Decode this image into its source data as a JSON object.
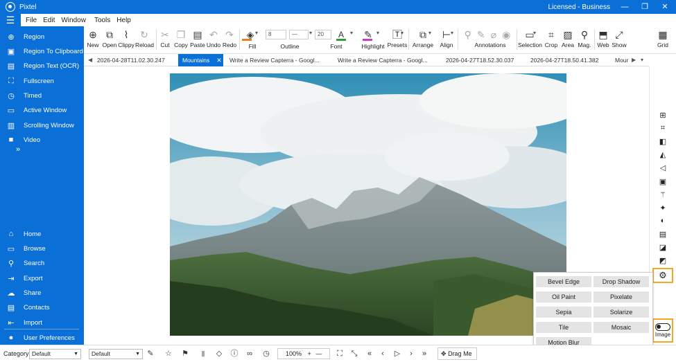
{
  "app": {
    "title": "Pixtel",
    "license": "Licensed - Business",
    "window_buttons": {
      "minimize": "—",
      "restore": "❐",
      "close": "✕"
    }
  },
  "menu": [
    "File",
    "Edit",
    "Window",
    "Tools",
    "Help"
  ],
  "sidebar": {
    "capture": [
      {
        "label": "Region",
        "icon": "region-icon"
      },
      {
        "label": "Region To Clipboard",
        "icon": "clipboard-icon"
      },
      {
        "label": "Region Text (OCR)",
        "icon": "ocr-icon"
      },
      {
        "label": "Fullscreen",
        "icon": "fullscreen-icon"
      },
      {
        "label": "Timed",
        "icon": "timer-icon"
      },
      {
        "label": "Active Window",
        "icon": "window-icon"
      },
      {
        "label": "Scrolling Window",
        "icon": "scroll-icon"
      },
      {
        "label": "Video",
        "icon": "video-icon"
      }
    ],
    "expand": "»",
    "nav": [
      {
        "label": "Home",
        "icon": "home-icon"
      },
      {
        "label": "Browse",
        "icon": "browse-icon"
      },
      {
        "label": "Search",
        "icon": "search-icon"
      },
      {
        "label": "Export",
        "icon": "export-icon"
      },
      {
        "label": "Share",
        "icon": "share-icon"
      },
      {
        "label": "Contacts",
        "icon": "contacts-icon"
      },
      {
        "label": "Import",
        "icon": "import-icon"
      }
    ],
    "preferences": {
      "label": "User Preferences",
      "icon": "user-icon"
    }
  },
  "toolbar": {
    "new": "New",
    "open": "Open",
    "clippy": "Clippy",
    "reload": "Reload",
    "cut": "Cut",
    "copy": "Copy",
    "paste": "Paste",
    "undo": "Undo",
    "redo": "Redo",
    "fill": "Fill",
    "outline": "Outline",
    "outline_size": "8",
    "font": "Font",
    "font_size": "20",
    "highlight": "Highlight",
    "presets": "Presets",
    "arrange": "Arrange",
    "align": "Align",
    "annotations": "Annotations",
    "selection": "Selection",
    "crop": "Crop",
    "area": "Area",
    "mag": "Mag.",
    "web": "Web",
    "show": "Show",
    "grid": "Grid",
    "fill_color": "#e8821e",
    "font_color": "#2e9e3a",
    "highlight_color": "#c83cc8"
  },
  "tabs": [
    {
      "label": "2026-04-28T11.02.30.247"
    },
    {
      "label": "Mountains",
      "active": true,
      "close": "✕"
    },
    {
      "label": "Write a Review  Capterra - Googl..."
    },
    {
      "label": "Write a Review  Capterra - Googl..."
    },
    {
      "label": "2026-04-27T18.52.30.037"
    },
    {
      "label": "2026-04-27T18.50.41.382"
    },
    {
      "label": "Mour"
    }
  ],
  "effects": [
    "Bevel Edge",
    "Drop Shadow",
    "Oil Paint",
    "Pixelate",
    "Sepia",
    "Solarize",
    "Tile",
    "Mosaic",
    "Motion Blur"
  ],
  "rightbar": {
    "image_label": "Image"
  },
  "status": {
    "category_label": "Category",
    "category_value": "Default",
    "style_value": "Default",
    "zoom": "100%",
    "drag": "Drag Me"
  },
  "colors": {
    "brand": "#0a6fd6",
    "highlight_border": "#f5a623"
  }
}
